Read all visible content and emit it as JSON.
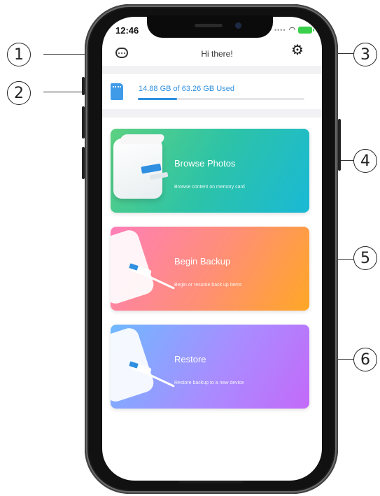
{
  "status_bar": {
    "time": "12:46"
  },
  "header": {
    "title": "Hi there!"
  },
  "storage": {
    "text": "14.88 GB of 63.26 GB Used",
    "used_fraction": 0.235
  },
  "cards": [
    {
      "title": "Browse Photos",
      "subtitle": "Browse content on memory card"
    },
    {
      "title": "Begin Backup",
      "subtitle": "Begin or resume back up items"
    },
    {
      "title": "Restore",
      "subtitle": "Restore backup to a new device"
    }
  ],
  "callouts": [
    "1",
    "2",
    "3",
    "4",
    "5",
    "6"
  ],
  "icons": {
    "chat": "chat-bubble-icon",
    "settings": "gear-icon",
    "memory_card": "sd-card-icon"
  },
  "colors": {
    "accent": "#2f8fe0",
    "card_browse": [
      "#5cd181",
      "#1ab9d6"
    ],
    "card_backup": [
      "#ff7fb8",
      "#ffa726"
    ],
    "card_restore": [
      "#6fb9ff",
      "#c36af9"
    ]
  }
}
